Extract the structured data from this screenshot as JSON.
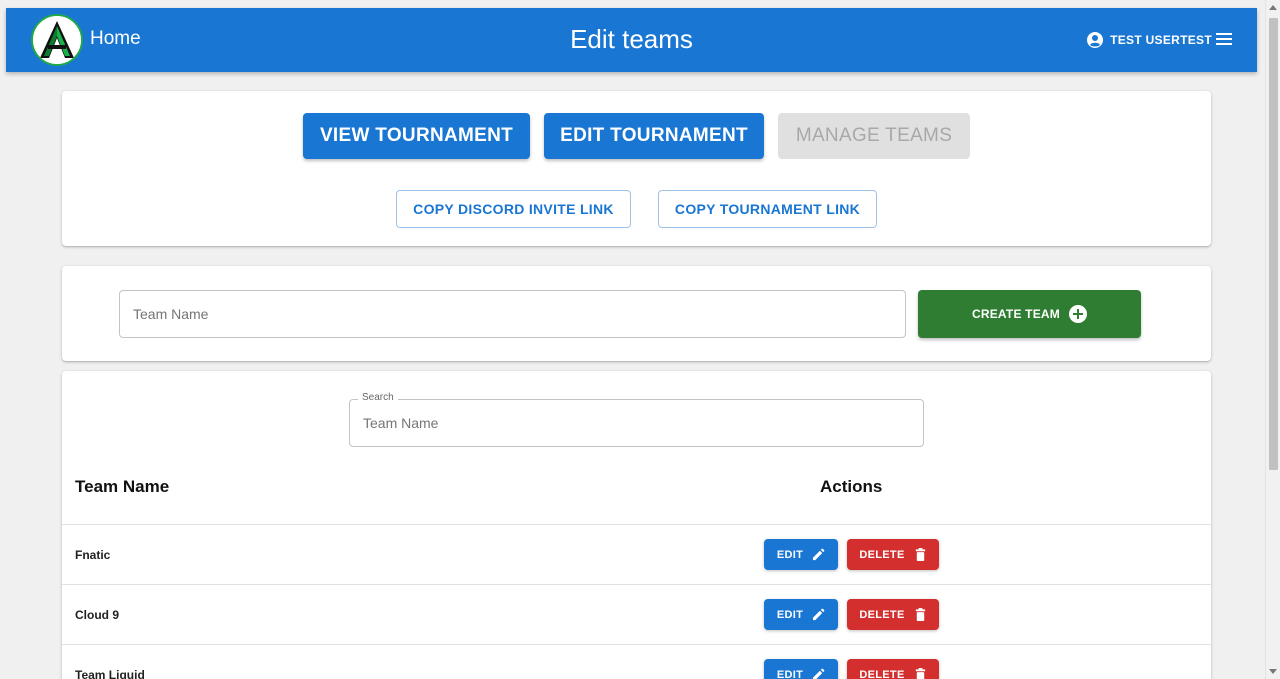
{
  "appbar": {
    "home_label": "Home",
    "title": "Edit teams",
    "user_name": "TEST USERTEST",
    "color": "#1976d2"
  },
  "tournament_actions": {
    "view_label": "VIEW TOURNAMENT",
    "edit_label": "EDIT TOURNAMENT",
    "manage_label": "MANAGE TEAMS",
    "copy_discord_label": "COPY DISCORD INVITE LINK",
    "copy_tournament_label": "COPY TOURNAMENT LINK"
  },
  "create_team": {
    "input_placeholder": "Team Name",
    "button_label": "CREATE TEAM",
    "button_color": "#2e7d32"
  },
  "search": {
    "legend": "Search",
    "placeholder": "Team Name"
  },
  "table": {
    "headers": {
      "team_name": "Team Name",
      "actions": "Actions"
    },
    "rows": [
      {
        "name": "Fnatic",
        "edit_label": "EDIT",
        "delete_label": "DELETE"
      },
      {
        "name": "Cloud 9",
        "edit_label": "EDIT",
        "delete_label": "DELETE"
      },
      {
        "name": "Team Liquid",
        "edit_label": "EDIT",
        "delete_label": "DELETE"
      }
    ],
    "delete_color": "#d32f2f"
  }
}
